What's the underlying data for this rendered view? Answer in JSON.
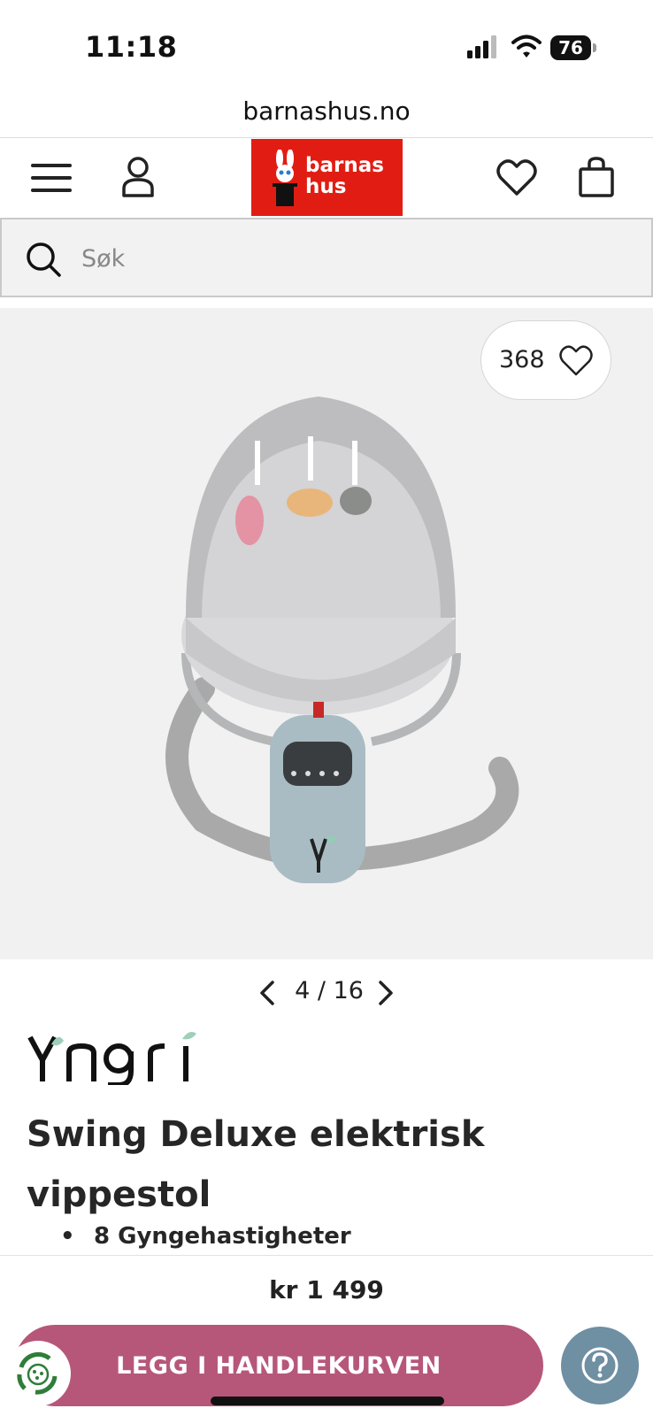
{
  "status_bar": {
    "time": "11:18",
    "battery": "76"
  },
  "browser": {
    "url": "barnashus.no"
  },
  "header": {
    "logo_line1": "barnas",
    "logo_line2": "hus",
    "icons": [
      "menu-icon",
      "user-icon",
      "heart-icon",
      "shopping-bag-icon"
    ]
  },
  "search": {
    "placeholder": "Søk"
  },
  "product": {
    "favorites_count": "368",
    "pager": {
      "current": "4",
      "separator": "/",
      "total": "16"
    },
    "brand": "Yngri",
    "title": "Swing Deluxe elektrisk vippestol",
    "features": [
      "8 Gyngehastigheter"
    ],
    "price": "kr 1 499"
  },
  "actions": {
    "add_to_cart": "LEGG I HANDLEKURVEN"
  },
  "colors": {
    "logo_red": "#e11d13",
    "cta_pink": "#b6577a",
    "help_blue": "#6f8fa3",
    "image_bg": "#f1f1f1"
  }
}
